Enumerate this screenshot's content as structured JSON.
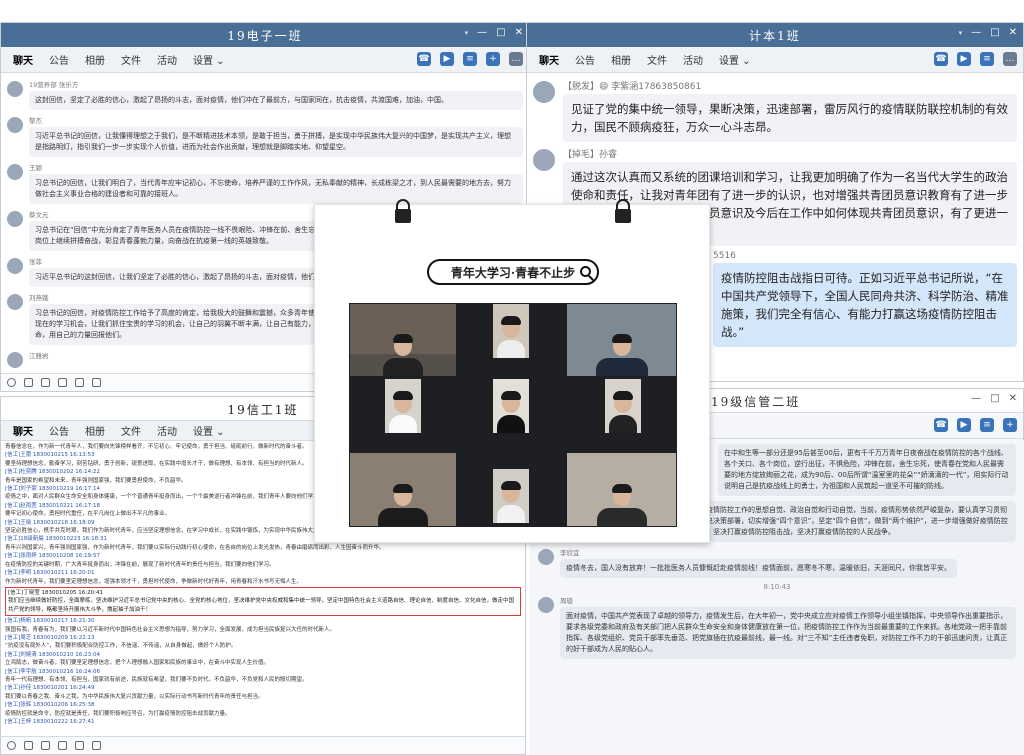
{
  "windows": {
    "w1": {
      "title": "19电子一班",
      "tabs": [
        "聊天",
        "公告",
        "相册",
        "文件",
        "活动",
        "设置 ⌄"
      ],
      "messages": [
        {
          "name": "19营养部 张乐方",
          "text": "这封回信，坚定了必胜的信心，激起了昂扬的斗志，面对疫情，他们冲在了最前方，与国家同在，抗击疫情，共渡国难，加油，中国。"
        },
        {
          "name": "黎杰",
          "text": "习近平总书记的回信，让我懂得理想之于我们，是不断精进技术本领，是敢于担当，勇于拼搏，是实现中华民族伟大复兴的中国梦，是实现共产主义，理想是指路明灯，指引我们一步一步实现个人价值，进而为社会作出贡献，理想就是脚踏实地、仰望星空。"
        },
        {
          "name": "王颖",
          "text": "习总书记的回信，让我们明白了，当代青年应牢记初心，不忘使命，培养严谨的工作作风，无私奉献的精神，长成栋梁之才，到人民最需要的地方去，努力做社会主义事业合格的建设者和可靠的接班人。"
        },
        {
          "name": "蔡文元",
          "text": "习总书记在“回信”中充分肯定了青年医务人员在疫情防控一线不畏艰险、冲锋在前、舍生忘死的精神，鼓励他们在党和人民最需要的时候冲锋在前，在各自岗位上继续拼搏奋战，彰显青春蓬勃力量，向奋战在抗疫第一线的英雄致敬。"
        },
        {
          "name": "张菲",
          "text": "习近平总书记的这封回信，让我们坚定了必胜的信心，激起了昂扬的斗志，面对疫情，他们冲在了最前方。"
        },
        {
          "name": "刘燕娥",
          "text": "习总书记的回信，对疫情防控工作给予了高度的肯定，给我极大的鼓舞和震撼，众多青年使命的志愿者们，为抗击疫情作出了巨大的贡献，让我们更加珍惜现在的学习机会，让我们抓住宝贵的学习的机会，让自己的羽翼不断丰满，让自己有能力，自从父母给我们生命的那一刻起，我们就有了责任，就有了使命，用自己的力量回报他们。"
        },
        {
          "name": "江雅岩",
          "text": ""
        }
      ]
    },
    "w2": {
      "title": "计本1班",
      "tabs": [
        "聊天",
        "公告",
        "相册",
        "文件",
        "活动",
        "设置 ⌄"
      ],
      "messages": [
        {
          "name": "【脱发】😄 李紫涵17863850861",
          "text": "见证了党的集中统一领导，果断决策，迅速部署，雷厉风行的疫情联防联控机制的有效力，国民不顾病疫狂，万众一心斗志昂。"
        },
        {
          "name": "【掉毛】孙睿",
          "text": "通过这次认真而又系统的团课培训和学习，让我更加明确了作为一名当代大学生的政治使命和责任，让我对青年团有了进一步的认识，也对增强共青团员意识教育有了进一步的认识，对如何增强共青团员意识及今后在工作中如何体现共青团员意识，有了更进一步的认识。"
        },
        {
          "name": "5516",
          "text": "疫情防控阻击战指日可待。正如习近平总书记所说，“在中国共产党领导下，全国人民同舟共济、科学防治、精准施策，我们完全有信心、有能力打赢这场疫情防控阻击战。”"
        }
      ]
    },
    "w3": {
      "title": "19信工1班",
      "tabs": [
        "聊天",
        "公告",
        "相册",
        "文件",
        "活动",
        "设置 ⌄"
      ],
      "log": [
        {
          "kind": "text",
          "text": "青春信念在，作为新一代青年人，我们要向先锋榜样看齐，不忘初心、牢记使命，勇于担当、砥砺前行，做新时代的奋斗者。"
        },
        {
          "kind": "meta",
          "text": "[信工]王蕾 1830010215 16:13:53"
        },
        {
          "kind": "text",
          "text": "要坚持理想信念，勤奋学习，刻苦钻研，勇于创新，锐意进取，在实践中增长才干，做有理想、有本领、有担当的时代新人。"
        },
        {
          "kind": "meta",
          "text": "[信工]杜奕腾 1830010202 16:14:22"
        },
        {
          "kind": "text",
          "text": "青年是国家的希望和未来，青年强则国家强，我们要勇担使命，不负韶华。"
        },
        {
          "kind": "meta",
          "text": "[信工]刘子豪 1830010219 16:17:14"
        },
        {
          "kind": "text",
          "text": "疫情之中，面对人民群众生命安全和身体健康，一个个普通青年挺身而出，一个个最美逆行者冲锋在前，我们青年人要向他们学习，担当起时代赋予的责任。"
        },
        {
          "kind": "meta",
          "text": "[信工]赵雨萱 1830010221 16:17:18"
        },
        {
          "kind": "text",
          "text": "要牢记初心使命，勇担时代重任，在平凡岗位上做出不平凡的事业。"
        },
        {
          "kind": "meta",
          "text": "[信工]王晓 1830010218 16:18:09"
        },
        {
          "kind": "text",
          "text": "坚定必胜信心，携手共克时艰，我们作为新时代青年，应当坚定理想信念，在学习中成长，在实践中锻炼，为实现中华民族伟大复兴的中国梦贡献青春力量。"
        },
        {
          "kind": "meta",
          "text": "[信工]18级新晨 1830010223 16:18:31"
        },
        {
          "kind": "text",
          "text": "青年兴则国家兴，青年强则国家强，作为新时代青年，我们要以实际行动践行初心使命，在各自的岗位上发光发热，青春由磨砺而出彩，人生因奋斗而升华。"
        },
        {
          "kind": "meta",
          "text": "[信工]张雨婷 1830010208 16:19:57"
        },
        {
          "kind": "text",
          "text": "在疫情防控的关键时期，广大青年挺身而出，冲锋在前，展现了新时代青年的责任与担当，我们要向他们学习。"
        },
        {
          "kind": "meta",
          "text": "[信工]李明 1830010211 16:20:01"
        },
        {
          "kind": "text",
          "text": "作为新时代青年，我们要坚定理想信念，增强本领才干，勇担时代使命，争做新时代好青年，用青春和汗水书写无悔人生。"
        }
      ],
      "highlight": {
        "meta": "[信工]丁晓莹 1830010205 16:20:41",
        "text": "我们应当继续做好防控，全面摩练，坚决维护习近平总书记党中央的核心、全党的核心地位，坚决维护党中央权威和集中统一领导，坚定中国特色社会主义道路自信、理论自信、制度自信、文化自信，做走中国共产党的领导，略都坚持开展伟大斗争，撸起袖子加油干！"
      },
      "log2": [
        {
          "kind": "meta",
          "text": "[信工]杨帆 1830010217 16:21:30"
        },
        {
          "kind": "text",
          "text": "强国有我，青春有为，我们要以习近平新时代中国特色社会主义思想为指导，努力学习，全面发展，成为担当民族复兴大任的时代新人。"
        },
        {
          "kind": "meta",
          "text": "[信工]周芝 1830010209 16:22:13"
        },
        {
          "kind": "text",
          "text": "“抗疫没有局外人”，我们要积极配合防控工作，不信谣、不传谣，从自身做起，做好个人防护。"
        },
        {
          "kind": "meta",
          "text": "[信工]刘婉清 1830010210 16:23:04"
        },
        {
          "kind": "text",
          "text": "立鸿鹄志，做奋斗者，我们要坚定理想信念，把个人理想融入国家和民族的事业中，在奋斗中实现人生价值。"
        },
        {
          "kind": "meta",
          "text": "[信工]李宇航 1830010216 16:24:06"
        },
        {
          "kind": "text",
          "text": "青年一代有理想、有本领、有担当，国家就有前途，民族就有希望，我们要不负时代，不负韶华，不负党和人民的殷切期望。"
        },
        {
          "kind": "meta",
          "text": "[信工]孙佳 1830010201 16:24:49"
        },
        {
          "kind": "text",
          "text": "我们要以青春之我、奋斗之我，为中华民族伟大复兴贡献力量，以实际行动书写新时代青年的责任与担当。"
        },
        {
          "kind": "meta",
          "text": "[信工]张辉 1830010206 16:25:38"
        },
        {
          "kind": "text",
          "text": "疫情防控就是命令，防控就是责任，我们要积极响应号召，为打赢疫情防控阻击战贡献力量。"
        },
        {
          "kind": "meta",
          "text": "[信工]王梓 1830010222 16:27:41"
        }
      ]
    },
    "w4": {
      "title": "19级信管二班",
      "tabs": [],
      "messages": [
        {
          "name": "",
          "text": "在中和生等一部分还是95后甚至00后，更有千千万万青年日夜奋战在疫情防控的各个战线、各个关口、各个岗位，逆行出征，不惧危险，冲锋在前，舍生忘死，使青春在党和人民最需要的地方绽放绚丽之花，成为90后、00后所谓“温室里的花朵”“娇滴滴的一代”，用实际行动说明自己是抗疫战线上的勇士，为祖国和人民筑起一道坚不可摧的防线。"
        },
        {
          "name": "",
          "text": "面对疫情，要坚定必胜信心，进一步增强做好疫情防控工作的思想自觉、政治自觉和行动自觉，当前，疫情形势依然严峻复杂，要认真学习贯彻习近平总书记重要讲话、指示批示精神和党中央决策部署，切实增强“四个意识”，坚定“四个自信”，做到“两个维护”，进一步增强做好疫情防控工作的责任感和紧迫感，牢固树立一盘棋思想，坚决打赢疫情防控阻击战，坚决打赢疫情防控的人民战争。"
        },
        {
          "name": "李欣宜",
          "text": "疫情冬去，国人没有放弃！一批批医务人员慷慨赶赴疫情前线！疫情面前，愿寒冬不寒，温暖依旧，天涯同尺，你我皆平安。"
        },
        {
          "name": "",
          "text": "8:10:43"
        },
        {
          "name": "周璇",
          "text": "面对疫情，中国共产党表现了卓越的领导力，疫情发生后，在大年初一，党中央成立应对疫情工作领导小组坐镇指挥，中央领导作出重要指示，要求各级党委和政府及有关部门把人民群众生命安全和身体健康放在第一位，把疫情防控工作作为当前最重要的工作来抓。各地党政一把手靠前指挥、各级党组织、党员干部率先垂范、把党旗插在抗疫最前线，最一线。对“三不知”主任违者免职，对防控工作不力的干部迅速问责，让真正的好干部成为人民的贴心人。"
        }
      ]
    }
  },
  "poster": {
    "banner": "青年大学习·青春不止步"
  }
}
